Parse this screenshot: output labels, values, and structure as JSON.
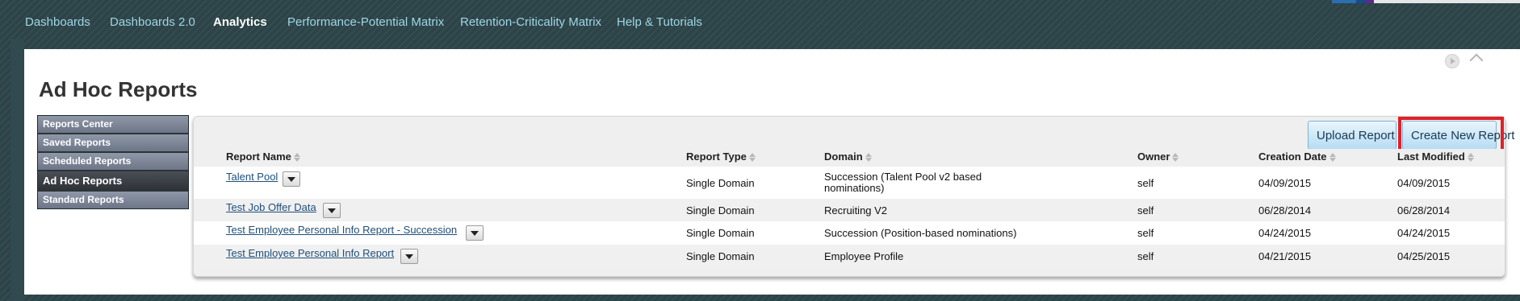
{
  "nav": {
    "items": [
      {
        "label": "Dashboards"
      },
      {
        "label": "Dashboards 2.0"
      },
      {
        "label": "Analytics",
        "active": true
      },
      {
        "label": "Performance-Potential Matrix"
      },
      {
        "label": "Retention-Criticality Matrix"
      },
      {
        "label": "Help & Tutorials"
      }
    ]
  },
  "colors": {
    "nav_link": "#9fd6e6",
    "nav_active": "#ffffff",
    "button_text": "#1a3a52",
    "highlight": "#e0202a",
    "link": "#1f4f7a"
  },
  "page": {
    "title": "Ad Hoc Reports"
  },
  "sidebar": {
    "items": [
      {
        "label": "Reports Center"
      },
      {
        "label": "Saved Reports"
      },
      {
        "label": "Scheduled Reports"
      },
      {
        "label": "Ad Hoc Reports",
        "active": true
      },
      {
        "label": "Standard Reports"
      }
    ]
  },
  "toolbar": {
    "upload_label": "Upload Report",
    "create_label": "Create New Report"
  },
  "table": {
    "headers": {
      "name": "Report Name",
      "type": "Report Type",
      "domain": "Domain",
      "owner": "Owner",
      "created": "Creation Date",
      "modified": "Last Modified"
    },
    "rows": [
      {
        "name": "Talent Pool",
        "type": "Single Domain",
        "domain": "Succession (Talent Pool v2 based nominations)",
        "owner": "self",
        "created": "04/09/2015",
        "modified": "04/09/2015"
      },
      {
        "name": "Test Job Offer Data",
        "type": "Single Domain",
        "domain": "Recruiting V2",
        "owner": "self",
        "created": "06/28/2014",
        "modified": "06/28/2014"
      },
      {
        "name": "Test Employee Personal Info Report - Succession",
        "type": "Single Domain",
        "domain": "Succession (Position-based nominations)",
        "owner": "self",
        "created": "04/24/2015",
        "modified": "04/24/2015"
      },
      {
        "name": "Test Employee Personal Info Report",
        "type": "Single Domain",
        "domain": "Employee Profile",
        "owner": "self",
        "created": "04/21/2015",
        "modified": "04/25/2015"
      }
    ]
  }
}
